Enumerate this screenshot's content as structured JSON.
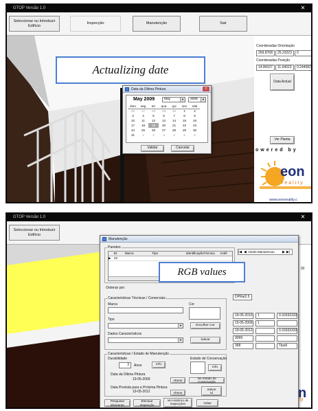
{
  "window": {
    "title": "GTOP Versão 1.0",
    "close_glyph": "✕"
  },
  "toolbar": {
    "items": [
      "Seleccionar ou Introduzir Edifício",
      "Inspecção",
      "Manutenção",
      "Sair"
    ]
  },
  "side_panel": {
    "orientation_label": "Coordenadas Orientação",
    "orientation_values": [
      "269.8768",
      "25.23223",
      "0"
    ],
    "position_label": "Coordenadas Posição",
    "position_values": [
      "14.84107",
      "11.64023",
      "0.244582"
    ],
    "date_button": "Data Actual",
    "view_button": "Ver Planta",
    "powered_by": "owered by",
    "logo_text": "eon",
    "logo_subtext": "reality",
    "url": "www.eonreality.c"
  },
  "captions": {
    "top": "Actualizing date",
    "bottom": "RGB values"
  },
  "calendar_dialog": {
    "title": "Data da Última Pintura",
    "header": "May 2009",
    "month_select": "May",
    "year_select": "2009",
    "weekdays": [
      "dom",
      "seg",
      "ter",
      "qua",
      "qui",
      "sex",
      "sáb"
    ],
    "weeks": [
      [
        "26",
        "27",
        "28",
        "29",
        "30",
        "1",
        "2"
      ],
      [
        "3",
        "4",
        "5",
        "6",
        "7",
        "8",
        "9"
      ],
      [
        "10",
        "11",
        "12",
        "13",
        "14",
        "15",
        "16"
      ],
      [
        "17",
        "18",
        "19",
        "20",
        "21",
        "22",
        "23"
      ],
      [
        "24",
        "25",
        "26",
        "27",
        "28",
        "29",
        "30"
      ],
      [
        "31",
        "1",
        "2",
        "3",
        "4",
        "5",
        "6"
      ]
    ],
    "selected_day": "19",
    "validate_button": "Validar",
    "cancel_button": "Cancelar"
  },
  "maint_dialog": {
    "title": "Manutenção",
    "paredes_label": "Paredes",
    "columns": [
      "ID",
      "Marca",
      "Tipo",
      "IdentificaçãoTécnica",
      "Antiê"
    ],
    "row": [
      "42",
      "",
      "",
      "",
      ""
    ],
    "nav_label": "Adodc:Manutencao",
    "order_label": "Ordenar por:",
    "tech_label": "Características Técnicas / Comerciais",
    "marca_label": "Marca",
    "cor_label": "Cor",
    "rgb_value": "DPRal2.5",
    "tipo_label": "Tipo",
    "choose_color": "Escolher Cor",
    "dados_label": "Dados Característicos",
    "save_button": "Salvar",
    "state_label": "Características / Estado de Manutenção",
    "durab_label": "Durabilidade",
    "durab_value": "3",
    "anos_label": "Anos",
    "info_button": "Info",
    "cons_label": "Estado de Conservação",
    "info2_button": "Info",
    "last_paint_label": "Data da Última Pintura",
    "last_paint_value": "19-05-2009",
    "alter_button": "Alterar",
    "view_state_button": "Ver Estado de Conservação",
    "next_paint_label": "Data Prevista para a Próxima Pintura",
    "next_paint_value": "19-05-2012",
    "alter2_button": "Alterar",
    "save2_button": "Salvar\ntd",
    "bottom_buttons": [
      "Pesquisar Elemento",
      "Efectuar Inspecção",
      "Ver Histórico de Inspecções",
      "Voltar"
    ]
  },
  "grid_fields": {
    "rows": [
      [
        "19-05-2010",
        "1",
        "0.333333333"
      ],
      [
        "19-05-2009",
        "1",
        ""
      ],
      [
        "19-05-2012",
        "",
        "0.333333333"
      ],
      [
        "9099",
        "",
        ""
      ],
      [
        "368",
        "",
        "Tipo6"
      ]
    ]
  },
  "bottom_right_value": "92"
}
